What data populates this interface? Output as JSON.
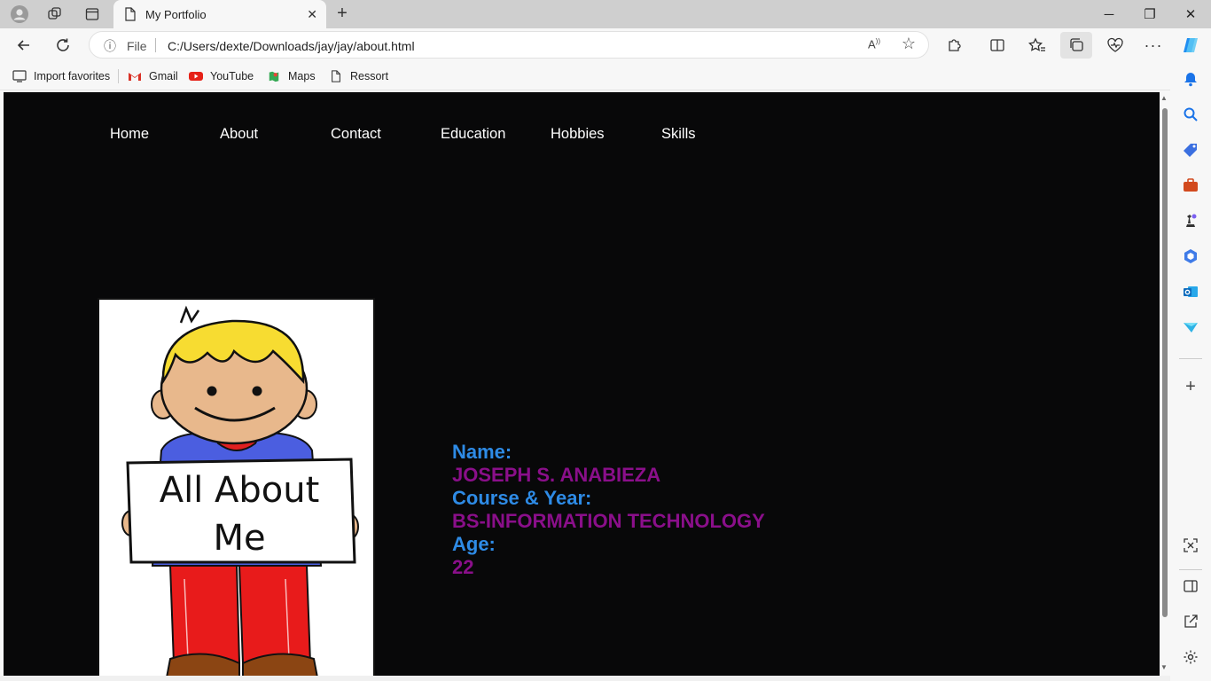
{
  "browser": {
    "tab": {
      "title": "My Portfolio"
    },
    "address": {
      "scheme_label": "File",
      "url": "C:/Users/dexte/Downloads/jay/jay/about.html"
    },
    "favorites": [
      {
        "label": "Import favorites",
        "icon": "import-icon"
      },
      {
        "label": "Gmail",
        "icon": "gmail-icon"
      },
      {
        "label": "YouTube",
        "icon": "youtube-icon"
      },
      {
        "label": "Maps",
        "icon": "maps-icon"
      },
      {
        "label": "Ressort",
        "icon": "page-icon"
      }
    ],
    "window_controls": {
      "minimize": "─",
      "restore": "❐",
      "close": "✕"
    }
  },
  "site": {
    "nav": [
      "Home",
      "About",
      "Contact",
      "Education",
      "Hobbies",
      "Skills"
    ],
    "image": {
      "sign_line1": "All About",
      "sign_line2": "Me"
    },
    "info": [
      {
        "label": "Name:",
        "value": "JOSEPH S. ANABIEZA"
      },
      {
        "label": "Course & Year:",
        "value": "BS-INFORMATION TECHNOLOGY"
      },
      {
        "label": "Age:",
        "value": "22"
      }
    ]
  },
  "colors": {
    "page_bg": "#080809",
    "label": "#2e8be6",
    "value": "#8a0f8a",
    "nav_text": "#ffffff"
  }
}
